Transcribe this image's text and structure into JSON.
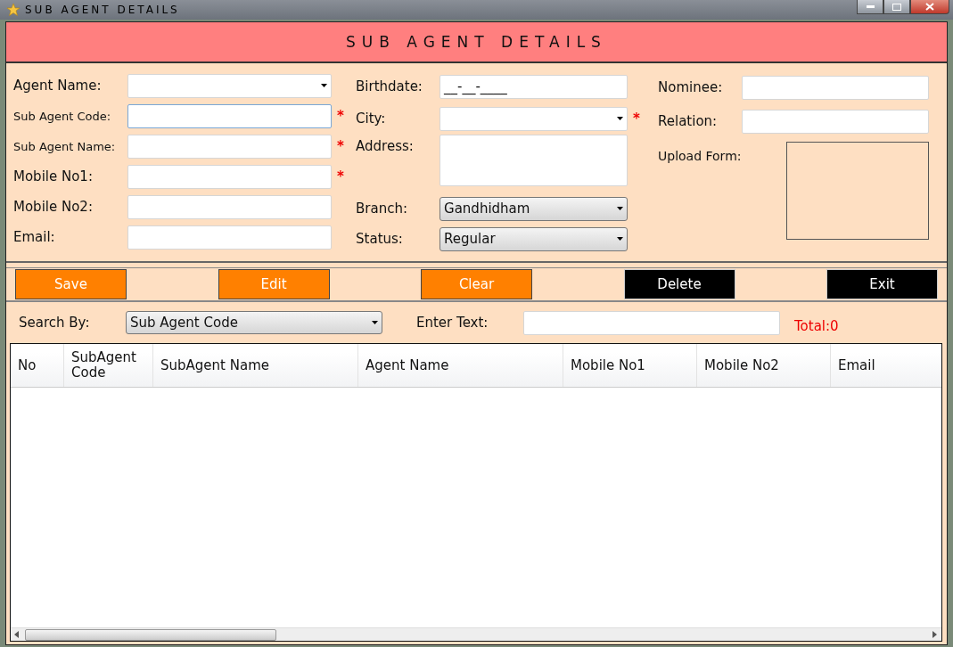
{
  "window": {
    "title": "SUB AGENT DETAILS"
  },
  "header": {
    "title": "SUB AGENT DETAILS"
  },
  "form_columns": [
    [
      {
        "label": "Agent Name:",
        "kind": "select",
        "focused": false
      },
      {
        "label": "Sub Agent Code:",
        "kind": "text",
        "marker": "*",
        "focused": true
      },
      {
        "label": "Sub Agent Name:",
        "kind": "text",
        "marker": "*",
        "focused": false
      },
      {
        "label": "Mobile No1:",
        "kind": "text",
        "marker": "*",
        "focused": false
      },
      {
        "label": "Mobile No2:",
        "kind": "text",
        "focused": false
      },
      {
        "label": "Email:",
        "kind": "text",
        "focused": false
      }
    ],
    [
      {
        "label": "Birthdate:",
        "kind": "text",
        "value": "__-__-____",
        "focused": false
      },
      {
        "label": "City:",
        "kind": "select",
        "marker": "*",
        "focused": false
      },
      {
        "label": "Address:",
        "kind": "textarea",
        "focused": false
      },
      {
        "label": "Branch:",
        "kind": "combo",
        "value": "Gandhidham",
        "focused": false
      },
      {
        "label": "Status:",
        "kind": "combo",
        "value": "Regular",
        "focused": false
      }
    ],
    [
      {
        "label": "Nominee:",
        "kind": "text",
        "focused": false
      },
      {
        "label": "Relation:",
        "kind": "text",
        "focused": false
      },
      {
        "label": "Upload Form:",
        "kind": "upload",
        "focused": false
      }
    ]
  ],
  "buttons": [
    {
      "label": "Save",
      "kind": "orange"
    },
    {
      "label": "Edit",
      "kind": "orange"
    },
    {
      "label": "Clear",
      "kind": "orange"
    },
    {
      "label": "Delete",
      "kind": "dark"
    },
    {
      "label": "Exit",
      "kind": "dark"
    }
  ],
  "search": {
    "label": "Search By:",
    "value": "Sub Agent Code",
    "text_label": "Enter Text:",
    "total": "Total:0"
  },
  "table": {
    "columns": [
      "No",
      "SubAgent Code",
      "SubAgent Name",
      "Agent Name",
      "Mobile No1",
      "Mobile No2",
      "Email"
    ]
  }
}
